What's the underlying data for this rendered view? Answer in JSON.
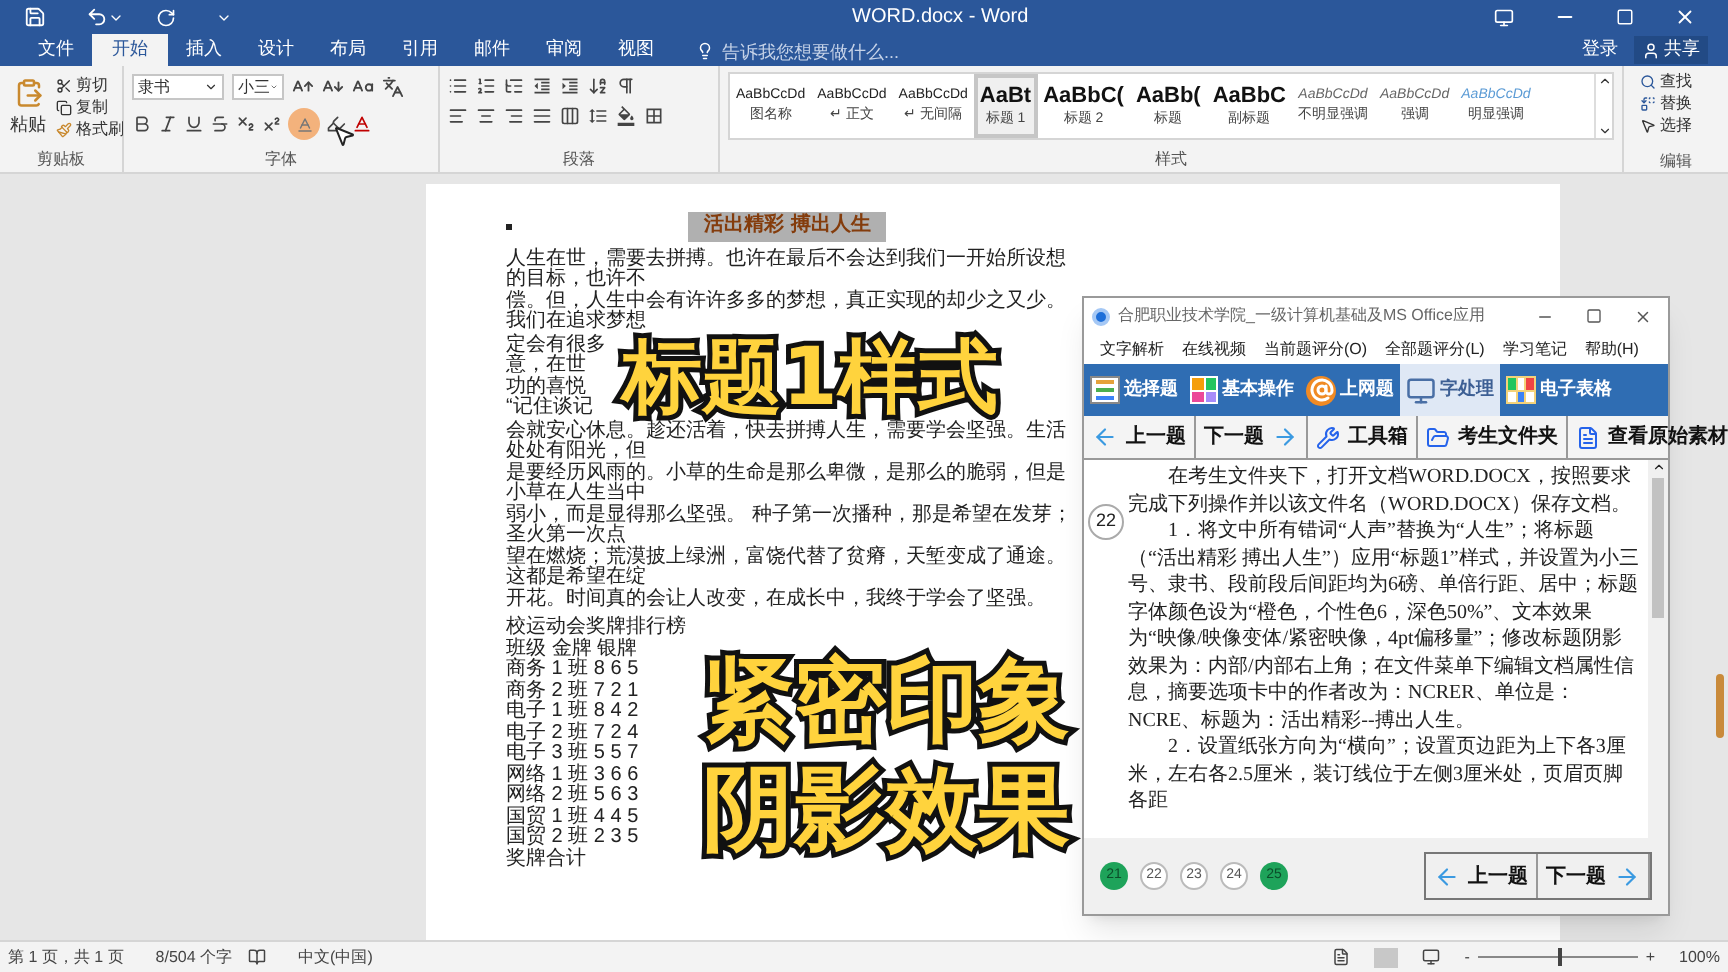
{
  "window": {
    "title": "WORD.docx - Word"
  },
  "tabs": [
    {
      "label": "文件",
      "selected": false
    },
    {
      "label": "开始",
      "selected": true
    },
    {
      "label": "插入",
      "selected": false
    },
    {
      "label": "设计",
      "selected": false
    },
    {
      "label": "布局",
      "selected": false
    },
    {
      "label": "引用",
      "selected": false
    },
    {
      "label": "邮件",
      "selected": false
    },
    {
      "label": "审阅",
      "selected": false
    },
    {
      "label": "视图",
      "selected": false
    }
  ],
  "tell_me": {
    "placeholder": "告诉我您想要做什么..."
  },
  "account": {
    "sign_in": "登录",
    "share": "共享"
  },
  "clipboard": {
    "paste": "粘贴",
    "cut": "剪切",
    "copy": "复制",
    "format_painter": "格式刷",
    "label": "剪贴板"
  },
  "font": {
    "name": "隶书",
    "size": "小三",
    "label": "字体"
  },
  "paragraph": {
    "label": "段落"
  },
  "styles": {
    "label": "样式",
    "items": [
      {
        "preview": "AaBbCcDd",
        "name": "图名称",
        "kind": "plain",
        "selected": false
      },
      {
        "preview": "AaBbCcDd",
        "name": "↵ 正文",
        "kind": "plain",
        "selected": false
      },
      {
        "preview": "AaBbCcDd",
        "name": "↵ 无间隔",
        "kind": "plain",
        "selected": false
      },
      {
        "preview": "AaBt",
        "name": "标题 1",
        "kind": "heading",
        "selected": true
      },
      {
        "preview": "AaBbC(",
        "name": "标题 2",
        "kind": "heading",
        "selected": false
      },
      {
        "preview": "AaBb(",
        "name": "标题",
        "kind": "heading",
        "selected": false
      },
      {
        "preview": "AaBbC",
        "name": "副标题",
        "kind": "heading",
        "selected": false
      },
      {
        "preview": "AaBbCcDd",
        "name": "不明显强调",
        "kind": "subtle",
        "selected": false
      },
      {
        "preview": "AaBbCcDd",
        "name": "强调",
        "kind": "subtle",
        "selected": false
      },
      {
        "preview": "AaBbCcDd",
        "name": "明显强调",
        "kind": "accent",
        "selected": false
      }
    ]
  },
  "editing": {
    "find": "查找",
    "replace": "替换",
    "select": "选择",
    "label": "编辑"
  },
  "document": {
    "title": "活出精彩 搏出人生",
    "lines_top": [
      "人生在世，需要去拼搏。也许在最后不会达到我们一开始所设想的目标，也许不",
      "偿。但，人生中会有许许多多的梦想，真正实现的却少之又少。我们在追求梦想"
    ],
    "lines_covered": [
      "定会有很多",
      "意，在世",
      "功的喜悦",
      "“记住谈记"
    ],
    "lines_bottom": [
      "会就安心休息。趁还活着，快去拼搏人生，需要学会坚强。生活处处有阳光，但",
      "是要经历风雨的。小草的生命是那么卑微，是那么的脆弱，但是小草在人生当中",
      "弱小，而是显得那么坚强。 种子第一次播种，那是希望在发芽；圣火第一次点",
      "望在燃烧；荒漠披上绿洲，富饶代替了贫瘠，天堑变成了通途。这都是希望在绽",
      "开花。时间真的会让人改变，在成长中，我终于学会了坚强。"
    ],
    "table_title": "校运动会奖牌排行榜",
    "table_header": "班级 金牌 银牌",
    "table_rows": [
      "商务 1 班 8 6 5",
      "商务 2 班 7 2 1",
      "电子 1 班 8 4 2",
      "电子 2 班 7 2 4",
      "电子 3 班 5 5 7",
      "网络 1 班 3 6 6",
      "网络 2 班 5 6 3",
      "国贸 1 班 4 4 5",
      "国贸 2 班 2 3 5"
    ],
    "table_total": "奖牌合计"
  },
  "captions": [
    "标题1样式",
    "紧密印象",
    "阴影效果"
  ],
  "exam_window": {
    "title": "合肥职业技术学院_一级计算机基础及MS Office应用",
    "menu": [
      "文字解析",
      "在线视频",
      "当前题评分(O)",
      "全部题评分(L)",
      "学习笔记",
      "帮助(H)"
    ],
    "tabs": [
      {
        "label": "选择题",
        "kind": "choice",
        "selected": false
      },
      {
        "label": "基本操作",
        "kind": "basic",
        "selected": false
      },
      {
        "label": "上网题",
        "kind": "web",
        "selected": false
      },
      {
        "label": "字处理",
        "kind": "word",
        "selected": true
      },
      {
        "label": "电子表格",
        "kind": "sheet",
        "selected": false
      }
    ],
    "nav": [
      {
        "label": "上一题",
        "kind": "prev"
      },
      {
        "label": "下一题",
        "kind": "next"
      },
      {
        "label": "工具箱",
        "kind": "tools"
      },
      {
        "label": "考生文件夹",
        "kind": "folder"
      },
      {
        "label": "查看原始素材",
        "kind": "file"
      }
    ],
    "question_number": "22",
    "paragraphs": [
      "在考生文件夹下，打开文档WORD.DOCX，按照要求完成下列操作并以该文件名（WORD.DOCX）保存文档。",
      "1．将文中所有错词“人声”替换为“人生”；将标题（“活出精彩 搏出人生”）应用“标题1”样式，并设置为小三号、隶书、段前段后间距均为6磅、单倍行距、居中；标题字体颜色设为“橙色，个性色6，深色50%”、文本效果为“映像/映像变体/紧密映像，4pt偏移量”；修改标题阴影效果为：内部/内部右上角；在文件菜单下编辑文档属性信息，摘要选项卡中的作者改为：NCRER、单位是：NCRE、标题为：活出精彩--搏出人生。",
      "2．设置纸张方向为“横向”；设置页边距为上下各3厘米，左右各2.5厘米，装订线位于左侧3厘米处，页眉页脚各距"
    ],
    "questions": [
      {
        "number": "21",
        "answered": true
      },
      {
        "number": "22",
        "answered": false
      },
      {
        "number": "23",
        "answered": false
      },
      {
        "number": "24",
        "answered": false
      },
      {
        "number": "25",
        "answered": true
      }
    ],
    "footer_buttons": [
      {
        "label": "上一题",
        "kind": "prev"
      },
      {
        "label": "下一题",
        "kind": "next"
      }
    ]
  },
  "status_bar": {
    "page": "第 1 页，共 1 页",
    "words": "8/504 个字",
    "language": "中文(中国)",
    "zoom": {
      "level": 0.5,
      "reading": "100%",
      "minus": "-",
      "plus": "+"
    }
  }
}
